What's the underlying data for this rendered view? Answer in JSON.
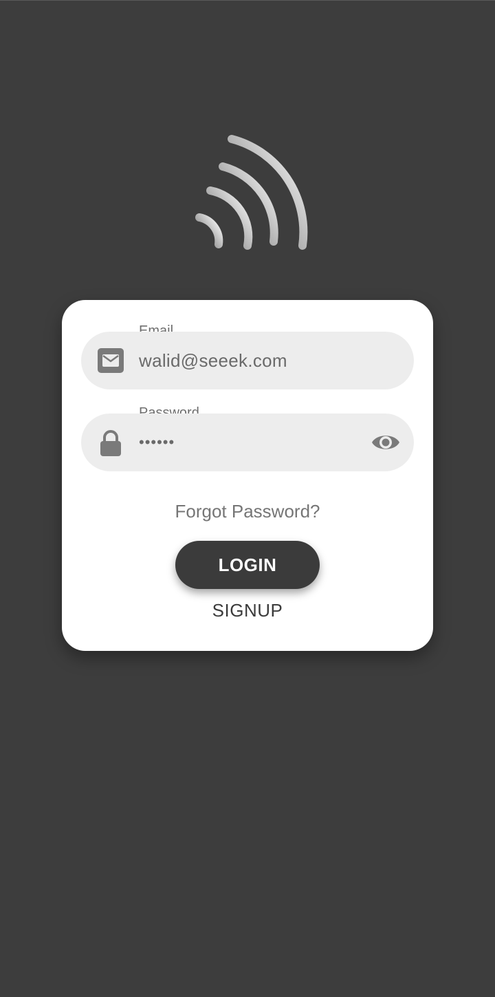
{
  "logo": {
    "icon": "signal-waves-icon"
  },
  "login_form": {
    "email": {
      "label": "Email",
      "value": "walid@seeek.com",
      "icon": "mail-icon"
    },
    "password": {
      "label": "Password",
      "value": "••••••",
      "icon": "lock-icon",
      "toggle_icon": "eye-icon"
    },
    "forgot_password_label": "Forgot Password?",
    "login_label": "LOGIN",
    "signup_label": "SIGNUP"
  },
  "colors": {
    "background": "#3d3d3d",
    "card": "#ffffff",
    "field_background": "#ededed",
    "primary_button": "#3b3b3b",
    "icon": "#7a7a7a"
  }
}
